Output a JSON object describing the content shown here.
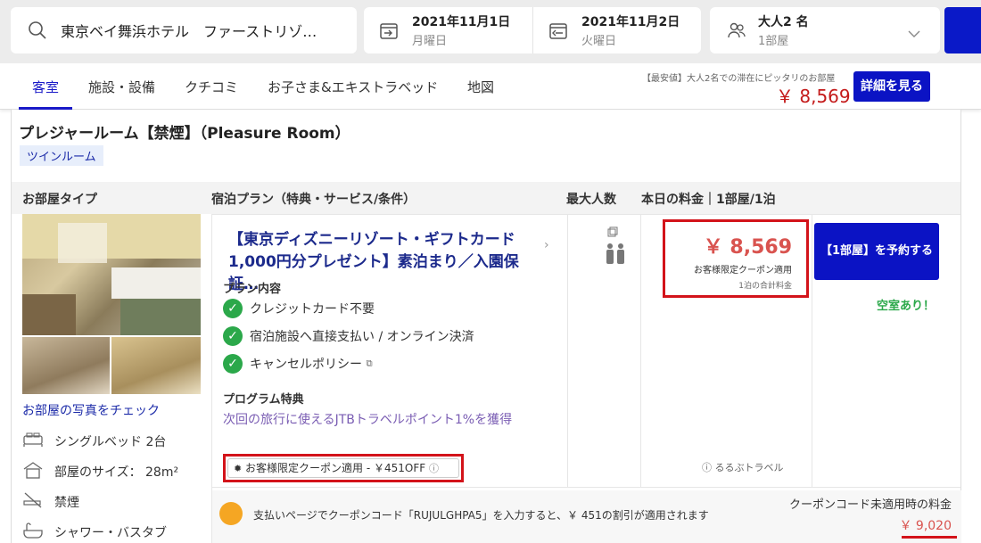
{
  "search": {
    "destination": "東京ベイ舞浜ホテル　ファーストリゾ…",
    "checkin_date": "2021年11月1日",
    "checkin_day": "月曜日",
    "checkout_date": "2021年11月2日",
    "checkout_day": "火曜日",
    "guests": "大人2 名",
    "rooms": "1部屋"
  },
  "tabs": [
    "客室",
    "施設・設備",
    "クチコミ",
    "お子さま&エキストラベッド",
    "地図"
  ],
  "lowest": {
    "note": "【最安値】大人2名での滞在にピッタリのお部屋",
    "price": "￥ 8,569",
    "detail_button": "詳細を見る"
  },
  "room": {
    "title": "プレジャールーム【禁煙】（Pleasure Room）",
    "badge": "ツインルーム",
    "columns": {
      "room_type": "お部屋タイプ",
      "plan": "宿泊プラン（特典・サービス/条件）",
      "max_people": "最大人数",
      "price": "本日の料金｜1部屋/1泊"
    },
    "photo_link": "お部屋の写真をチェック",
    "features": [
      {
        "icon": "bed-icon",
        "text": "シングルベッド 2台"
      },
      {
        "icon": "room-size-icon",
        "text": "部屋のサイズ： 28m²"
      },
      {
        "icon": "no-smoking-icon",
        "text": "禁煙"
      },
      {
        "icon": "shower-bath-icon",
        "text": "シャワー・バスタブ"
      }
    ]
  },
  "plan": {
    "title": "【東京ディズニーリゾート・ギフトカード1,000円分プレゼント】素泊まり／入園保証…",
    "contents_label": "プラン内容",
    "checks": [
      "クレジットカード不要",
      "宿泊施設へ直接支払い / オンライン決済",
      "キャンセルポリシー"
    ],
    "program_label": "プログラム特典",
    "program_text": "次回の旅行に使えるJTBトラベルポイント1%を獲得",
    "coupon_tag": "お客様限定クーポン適用 - ￥451OFF"
  },
  "price": {
    "amount": "￥ 8,569",
    "coupon_note": "お客様限定クーポン適用",
    "total_note": "1泊の合計料金",
    "provider": "るるぶトラベル"
  },
  "booking": {
    "button": "【1部屋】を予約する",
    "availability": "空室あり！"
  },
  "coupon_bar": {
    "message": "支払いページでクーポンコード「RUJULGHPA5」を入力すると、￥ 451の割引が適用されます",
    "label": "クーポンコード未適用時の料金",
    "original_price": "￥ 9,020"
  },
  "colors": {
    "brand_blue": "#0b13c4",
    "price_red": "#d9534f",
    "highlight_red": "#d3131a",
    "check_green": "#2ba84a"
  }
}
